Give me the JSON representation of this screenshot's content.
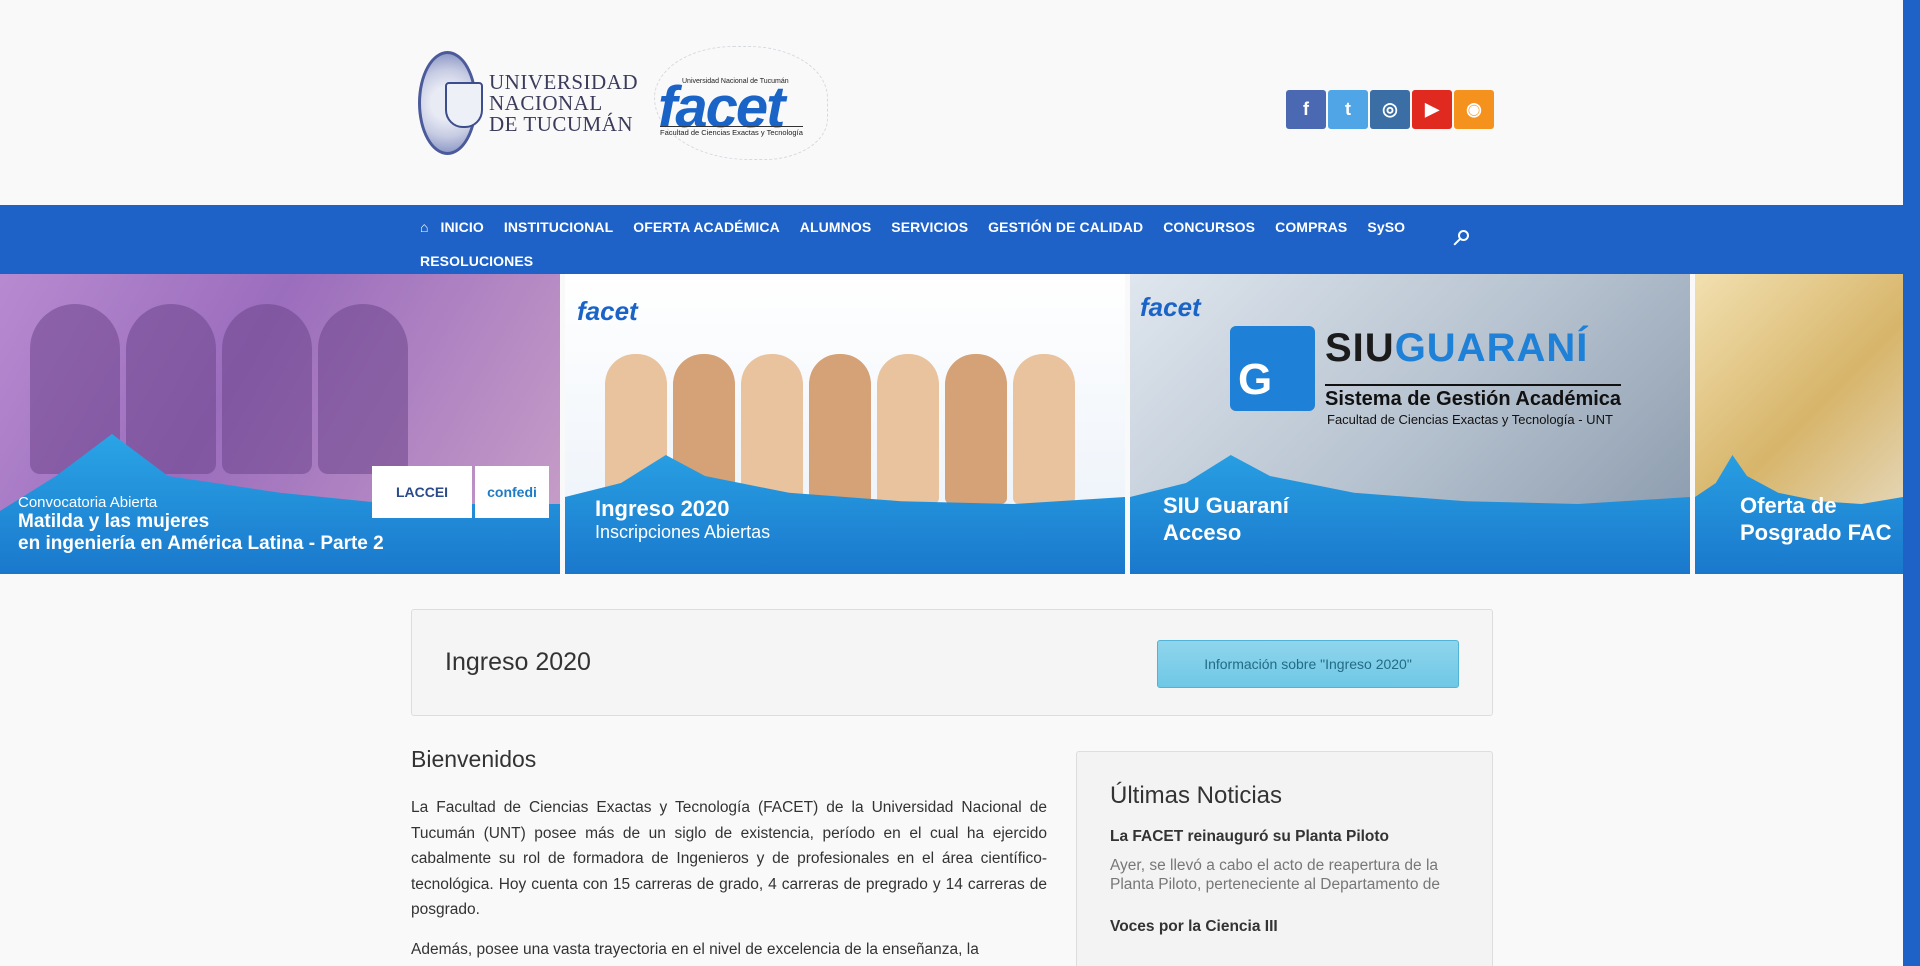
{
  "header": {
    "university_name": [
      "UNIVERSIDAD",
      "NACIONAL",
      "DE TUCUMÁN"
    ],
    "facet_logo_word": "facet",
    "facet_logo_top": "Universidad Nacional de Tucumán",
    "facet_logo_sub": "Facultad de Ciencias Exactas y Tecnología",
    "social": [
      {
        "icon": "facebook-icon",
        "glyph": "f"
      },
      {
        "icon": "twitter-icon",
        "glyph": "t"
      },
      {
        "icon": "instagram-icon",
        "glyph": "◎"
      },
      {
        "icon": "youtube-icon",
        "glyph": "▶"
      },
      {
        "icon": "rss-icon",
        "glyph": "◉"
      }
    ]
  },
  "nav": {
    "home_icon": "home-icon",
    "items": [
      "INICIO",
      "INSTITUCIONAL",
      "OFERTA ACADÉMICA",
      "ALUMNOS",
      "SERVICIOS",
      "GESTIÓN DE CALIDAD",
      "CONCURSOS",
      "COMPRAS",
      "SySO"
    ],
    "items_row2": [
      "RESOLUCIONES"
    ],
    "search_icon": "search-icon"
  },
  "slider": {
    "slides": [
      {
        "kicker": "Convocatoria Abierta",
        "title_line1": "Matilda y las mujeres",
        "title_line2": "en ingeniería en América Latina - Parte 2",
        "logos": [
          "LACCEI",
          "confedi"
        ]
      },
      {
        "logo": "facet",
        "title": "Ingreso 2020",
        "subtitle": "Inscripciones Abiertas"
      },
      {
        "logo": "facet",
        "brand_a": "SIU",
        "brand_b": "GUARANÍ",
        "brand_sub": "Sistema de Gestión Académica",
        "brand_sub2": "Facultad de Ciencias Exactas y Tecnología - UNT",
        "title_line1": "SIU Guaraní",
        "title_line2": "Acceso"
      },
      {
        "title_line1": "Oferta de",
        "title_line2": "Posgrado FAC"
      }
    ]
  },
  "ingreso": {
    "title": "Ingreso 2020",
    "button_label": "Información sobre \"Ingreso 2020\""
  },
  "main": {
    "heading": "Bienvenidos",
    "paragraph1": "La Facultad de Ciencias Exactas y Tecnología (FACET) de la Universidad Nacional de Tucumán (UNT) posee más de un siglo de existencia, período en el cual ha ejercido cabalmente su rol de formadora de Ingenieros y de profesionales en el área científico-tecnológica. Hoy cuenta con 15 carreras de grado, 4 carreras de pregrado y 14 carreras de posgrado.",
    "paragraph2": "Además, posee una vasta trayectoria en el nivel de excelencia de la enseñanza, la"
  },
  "sidebar": {
    "title": "Últimas Noticias",
    "news": [
      {
        "title": "La FACET reinauguró su Planta Piloto",
        "excerpt": "Ayer, se llevó a cabo el acto de reapertura de la Planta Piloto, perteneciente al Departamento de"
      },
      {
        "title": "Voces por la Ciencia III",
        "excerpt": ""
      }
    ]
  },
  "colors": {
    "nav": "#1e62c8",
    "accent": "#1a64c8",
    "button": "#6ec8e6"
  }
}
